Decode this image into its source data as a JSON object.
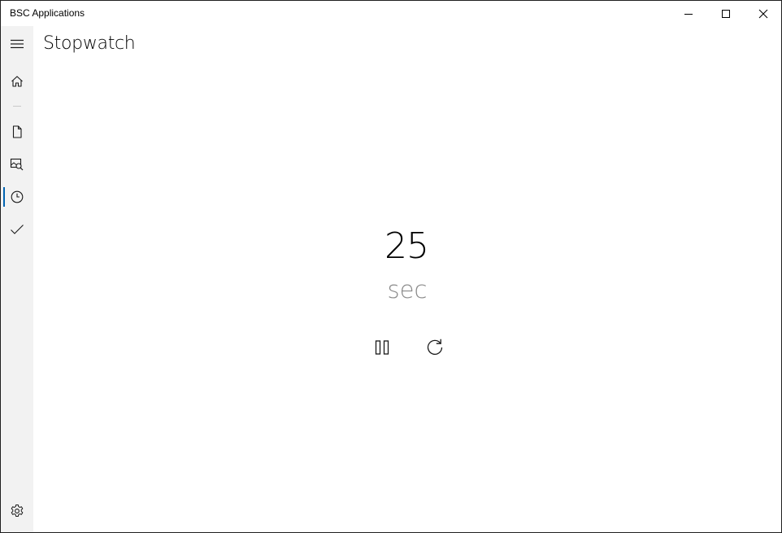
{
  "window": {
    "title": "BSC Applications",
    "controls": {
      "minimize_icon": "minimize-icon",
      "maximize_icon": "maximize-icon",
      "close_icon": "close-icon"
    }
  },
  "sidebar": {
    "items": [
      {
        "icon": "hamburger-menu-icon"
      },
      {
        "icon": "home-icon"
      },
      {
        "icon": "document-icon"
      },
      {
        "icon": "image-search-icon"
      },
      {
        "icon": "clock-icon",
        "selected": true
      },
      {
        "icon": "checkmark-icon"
      },
      {
        "icon": "gear-icon"
      }
    ],
    "accent_color": "#0063b1"
  },
  "page": {
    "title": "Stopwatch"
  },
  "stopwatch": {
    "value": "25",
    "unit": "sec",
    "controls": {
      "pause_icon": "pause-icon",
      "reset_icon": "refresh-icon"
    }
  }
}
